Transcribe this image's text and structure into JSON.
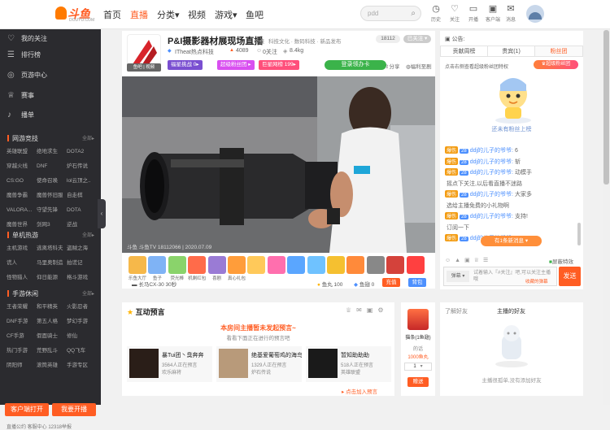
{
  "header": {
    "logo_text": "斗鱼",
    "logo_sub": "DOUYU.COM",
    "nav": [
      {
        "label": "首页",
        "active": false
      },
      {
        "label": "直播",
        "active": true
      },
      {
        "label": "分类▾",
        "active": false
      },
      {
        "label": "视频",
        "active": false
      },
      {
        "label": "游戏▾",
        "active": false
      },
      {
        "label": "鱼吧",
        "active": false
      }
    ],
    "search": {
      "placeholder": "pdd"
    },
    "tools": [
      {
        "icon": "clock-icon",
        "label": "历史"
      },
      {
        "icon": "heart-icon",
        "label": "关注"
      },
      {
        "icon": "video-icon",
        "label": "开播"
      },
      {
        "icon": "gift-icon",
        "label": "客户端"
      },
      {
        "icon": "message-icon",
        "label": "消息"
      }
    ],
    "accent": "#ff5d23"
  },
  "sidebar": {
    "items": [
      {
        "icon": "heart-icon",
        "label": "我的关注"
      },
      {
        "icon": "list-icon",
        "label": "排行榜"
      },
      {
        "icon": "globe-icon",
        "label": "页游中心"
      },
      {
        "icon": "trophy-icon",
        "label": "赛事"
      },
      {
        "icon": "mic-icon",
        "label": "播单"
      }
    ],
    "sections": [
      {
        "title": "网游竞技",
        "all": "全部▸",
        "items": [
          "英雄联盟",
          "绝地求生",
          "DOTA2",
          "穿越火线",
          "DNF",
          "炉石传说",
          "CS:GO",
          "使命召唤",
          "lol云顶之..",
          "魔兽争霸",
          "魔兽怀旧服",
          "自走棋",
          "VALORA...",
          "守望先锋",
          "DOTA",
          "魔兽世界",
          "剑网3",
          "逆战"
        ]
      },
      {
        "title": "单机热游",
        "all": "全部▸",
        "items": [
          "主机游戏",
          "逃离塔科夫",
          "盗贼之海",
          "谎人",
          "马里奥制造",
          "拍谎记",
          "怪物猎人",
          "仰日能源",
          "格斗游戏"
        ]
      },
      {
        "title": "手游休闲",
        "all": "全部▸",
        "items": [
          "王者荣耀",
          "和平精英",
          "火影忍者",
          "DNF手游",
          "第五人格",
          "梦幻手游",
          "CF手游",
          "假面骑士",
          "修仙",
          "热门手游",
          "荒野乱斗",
          "QQ飞车",
          "阴阳师",
          "滚筒英雄",
          "手游专区"
        ]
      }
    ],
    "btn_client": "客户端打开",
    "btn_live": "我要开播",
    "footer": "直播公约     客服中心     12318举报"
  },
  "room": {
    "title": "P&I摄影器材展现场直播",
    "category_prefix": "举报",
    "categories": "科技文化 · 数码科技 · 新品发布",
    "room_id": "18112",
    "follow_label": "已关注 ▾",
    "anchor": "ITheat热点科技",
    "level": "4089",
    "follow_count": "0关注",
    "hot": "8.4kg",
    "fishbar": "鱼吧 | 视频",
    "tags": [
      {
        "label": "福星挑战 0▸",
        "color": "#7a4fd1"
      },
      {
        "label": "超级粉丝团 ▸",
        "color": "#d94ff0"
      },
      {
        "label": "巨星网榜 199▸",
        "color": "#ff4f7b"
      }
    ],
    "gift_btn": "登录领办卡",
    "share": "分享",
    "client": "福利至剧",
    "watermark": "斗鱼 斗鱼TV 18112066 | 2020.07.09"
  },
  "gift_bar": {
    "gifts": [
      {
        "name": "乐鱼大厅",
        "color": "#f6b84a"
      },
      {
        "name": "鱼子",
        "color": "#7fb3f5"
      },
      {
        "name": "荧光棒",
        "color": "#8ad36b"
      },
      {
        "name": "机剩红包",
        "color": "#ff6b4a"
      },
      {
        "name": "喜剧",
        "color": "#9a7bd5"
      },
      {
        "name": "真心礼包",
        "color": "#ff9d3a"
      },
      {
        "name": "金爷",
        "color": "#ffc95a"
      },
      {
        "name": "超级甜蜜",
        "color": "#ff6fae"
      },
      {
        "name": "电竞",
        "color": "#5aa6ff"
      },
      {
        "name": "飞机",
        "color": "#6fc2ff"
      },
      {
        "name": "金条",
        "color": "#f5c030"
      },
      {
        "name": "666",
        "color": "#ff8a3a"
      },
      {
        "name": "赛车",
        "color": "#888"
      },
      {
        "name": "火箭",
        "color": "#d4423b"
      },
      {
        "name": "超火",
        "color": "#ff4040"
      }
    ],
    "item": "长马CX-30 30秒",
    "fishball_label": "鱼丸",
    "fishball": "100",
    "fishwing_label": "鱼翅",
    "fishwing": "0",
    "recharge": "充值",
    "backpack": "背包"
  },
  "preview": {
    "title": "互动预言",
    "notice": "本房间主播暂未发起预言~",
    "sub": "看看下面正在进行的预言吧",
    "items": [
      {
        "name": "暴Tui团丶臭奔奔",
        "viewers": "3564人正在预言",
        "cat": "欢乐麻将"
      },
      {
        "name": "绝基爱葡萄鸡的海鸟",
        "viewers": "1329人正在预言",
        "cat": "炉石传说"
      },
      {
        "name": "暂知助助助",
        "viewers": "518人正在预言",
        "cat": "英雄联盟"
      }
    ],
    "more": "▸ 点击加入预言"
  },
  "rank": {
    "title": "猫条(1鱼翅)",
    "sub": "的话",
    "price": "1000鱼丸",
    "qty": "1",
    "btn": "赠送"
  },
  "panel": {
    "notice": "公告:",
    "tabs": [
      "贡献周榜",
      "贵宾(1)",
      "粉丝团"
    ],
    "fanclub": "点击右侧查看超级粉丝团特权",
    "fanclub_btn": "超级粉丝团",
    "mascot_text": "还未有粉丝上榜",
    "chats": [
      {
        "lv": "爆伤",
        "badge": "28",
        "user": "ddj的儿子的爷爷:",
        "msg": "6"
      },
      {
        "lv": "爆伤",
        "badge": "28",
        "user": "ddj的儿子的爷爷:",
        "msg": "斩"
      },
      {
        "lv": "爆伤",
        "badge": "28",
        "user": "ddj的儿子的爷爷:",
        "msg": "动模手"
      },
      {
        "lv": "",
        "badge": "",
        "user": "",
        "msg": "摇点下关注,以后看直播不迷路"
      },
      {
        "lv": "爆伤",
        "badge": "28",
        "user": "ddj的儿子的爷爷:",
        "msg": "大家多"
      },
      {
        "lv": "",
        "badge": "",
        "user": "",
        "msg": "选给主播免费的小礼物啊"
      },
      {
        "lv": "爆伤",
        "badge": "28",
        "user": "ddj的儿子的爷爷:",
        "msg": "支持!"
      },
      {
        "lv": "",
        "badge": "",
        "user": "",
        "msg": "订阅一下"
      },
      {
        "lv": "爆伤",
        "badge": "28",
        "user": "ddj的儿子的爷爷:",
        "msg": "6"
      }
    ],
    "new_msgs": "有1条新消息 ▾",
    "mask": "屏蔽特效",
    "input_placeholder": "试着输入『#关注』吧,可以关注主播哦",
    "send": "发送",
    "daily": "收藏的弹幕",
    "friends_title": "了解好友",
    "friends_live": "主播的好友",
    "friends_empty": "主播很孤单,没有添加好友"
  }
}
